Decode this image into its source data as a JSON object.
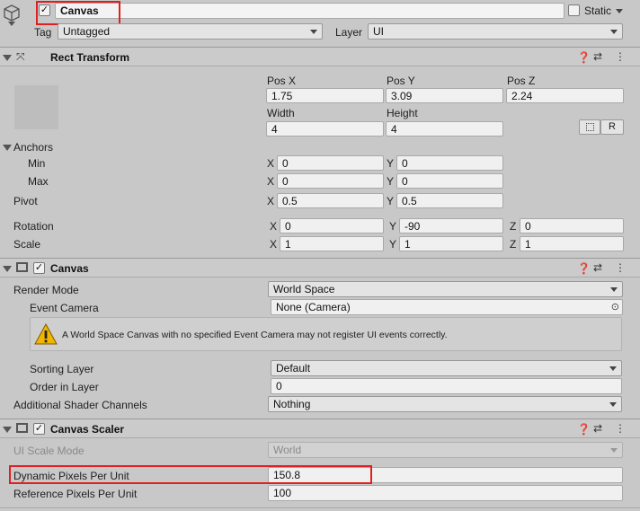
{
  "object": {
    "name": "Canvas",
    "static_label": "Static",
    "tag_label": "Tag",
    "tag_value": "Untagged",
    "layer_label": "Layer",
    "layer_value": "UI"
  },
  "rect_transform": {
    "title": "Rect Transform",
    "pos_x_label": "Pos X",
    "pos_x": "1.75",
    "pos_y_label": "Pos Y",
    "pos_y": "3.09",
    "pos_z_label": "Pos Z",
    "pos_z": "2.24",
    "width_label": "Width",
    "width": "4",
    "height_label": "Height",
    "height": "4",
    "r_button": "R",
    "anchors_label": "Anchors",
    "min_label": "Min",
    "min_x": "0",
    "min_y": "0",
    "max_label": "Max",
    "max_x": "0",
    "max_y": "0",
    "pivot_label": "Pivot",
    "pivot_x": "0.5",
    "pivot_y": "0.5",
    "rotation_label": "Rotation",
    "rot_x": "0",
    "rot_y": "-90",
    "rot_z": "0",
    "scale_label": "Scale",
    "scale_x": "1",
    "scale_y": "1",
    "scale_z": "1",
    "axis_x": "X",
    "axis_y": "Y",
    "axis_z": "Z"
  },
  "canvas": {
    "title": "Canvas",
    "render_mode_label": "Render Mode",
    "render_mode": "World Space",
    "event_camera_label": "Event Camera",
    "event_camera": "None (Camera)",
    "warning": "A World Space Canvas with no specified Event Camera may not register UI events correctly.",
    "sorting_layer_label": "Sorting Layer",
    "sorting_layer": "Default",
    "order_label": "Order in Layer",
    "order": "0",
    "shader_label": "Additional Shader Channels",
    "shader": "Nothing"
  },
  "canvas_scaler": {
    "title": "Canvas Scaler",
    "scale_mode_label": "UI Scale Mode",
    "scale_mode": "World",
    "dynamic_label": "Dynamic Pixels Per Unit",
    "dynamic": "150.8",
    "reference_label": "Reference Pixels Per Unit",
    "reference": "100"
  },
  "colors": {
    "highlight": "#e02020"
  }
}
